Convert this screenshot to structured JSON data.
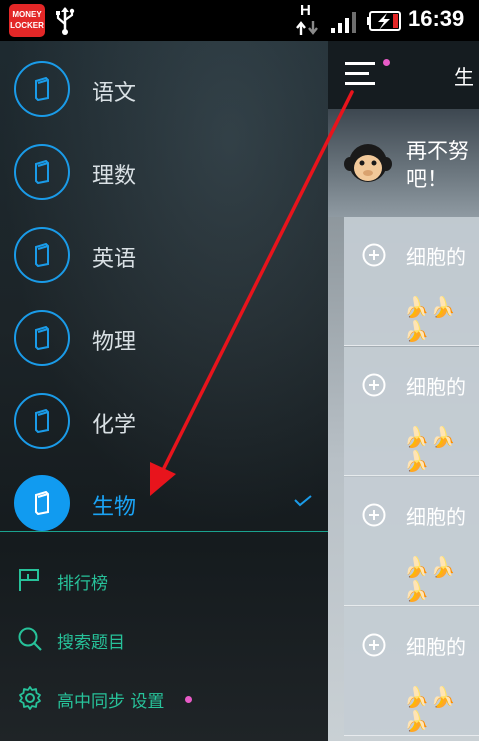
{
  "status_bar": {
    "app_badge_line1": "MONEY",
    "app_badge_line2": "LOCKER",
    "network_type": "H",
    "time": "16:39",
    "icons": [
      "money-locker-icon",
      "usb-icon",
      "network-h-icon",
      "signal-icon",
      "battery-charging-icon"
    ]
  },
  "drawer": {
    "subjects": [
      {
        "label": "语文",
        "active": false
      },
      {
        "label": "理数",
        "active": false
      },
      {
        "label": "英语",
        "active": false
      },
      {
        "label": "物理",
        "active": false
      },
      {
        "label": "化学",
        "active": false
      },
      {
        "label": "生物",
        "active": true
      }
    ],
    "bottom_items": [
      {
        "label": "排行榜",
        "icon": "flag-icon"
      },
      {
        "label": "搜索题目",
        "icon": "search-icon"
      },
      {
        "label": "高中同步 设置",
        "icon": "gear-icon",
        "badge": true
      }
    ],
    "colors": {
      "accent_blue": "#119bf0",
      "accent_green": "#27c29a",
      "badge_pink": "#e85bc7"
    }
  },
  "main": {
    "title": "生",
    "banner_text": "再不努\n吧！",
    "cards": [
      {
        "title": "细胞的",
        "bananas": "🍌🍌🍌"
      },
      {
        "title": "细胞的",
        "bananas": "🍌🍌🍌"
      },
      {
        "title": "细胞的",
        "bananas": "🍌🍌🍌"
      },
      {
        "title": "细胞的",
        "bananas": "🍌🍌🍌"
      }
    ]
  },
  "annotation": {
    "color": "#e8141c"
  }
}
